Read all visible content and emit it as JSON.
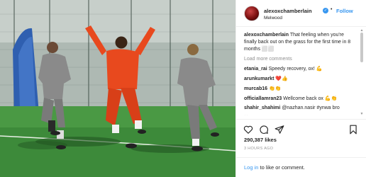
{
  "post": {
    "username": "alexoxchamberlain",
    "verified_icon": "verified-check-icon",
    "separator": "•",
    "follow_label": "Follow",
    "location": "Melwood",
    "caption_user": "alexoxchamberlain",
    "caption_text": "That feeling when you're finally back out on the grass for the first time in 8 months ⬜⬜",
    "load_more": "Load more comments",
    "likes": "290,387 likes",
    "time": "3 HOURS AGO",
    "login_link": "Log in",
    "login_rest": " to like or comment."
  },
  "comments": [
    {
      "user": "etania_rai",
      "text": "Speedy recovery, ox!",
      "emoji": "💪"
    },
    {
      "user": "arunkumarkt",
      "text": "",
      "emoji": "❤️👍"
    },
    {
      "user": "murcab16",
      "text": "",
      "emoji": "👏👏"
    },
    {
      "user": "officiallamran23",
      "text": "Wellcome back ox",
      "emoji": "💪👏"
    },
    {
      "user": "shahir_shahimi",
      "text": "@nazhan.nasir #ynwa bro",
      "emoji": "♥"
    }
  ],
  "icons": {
    "like": "heart-icon",
    "comment": "comment-icon",
    "share": "share-icon",
    "save": "bookmark-icon"
  },
  "colors": {
    "link": "#3897f0",
    "muted": "#8e8e8e",
    "player_kit": "#e8491e",
    "pitch": "#3d8a3a"
  }
}
